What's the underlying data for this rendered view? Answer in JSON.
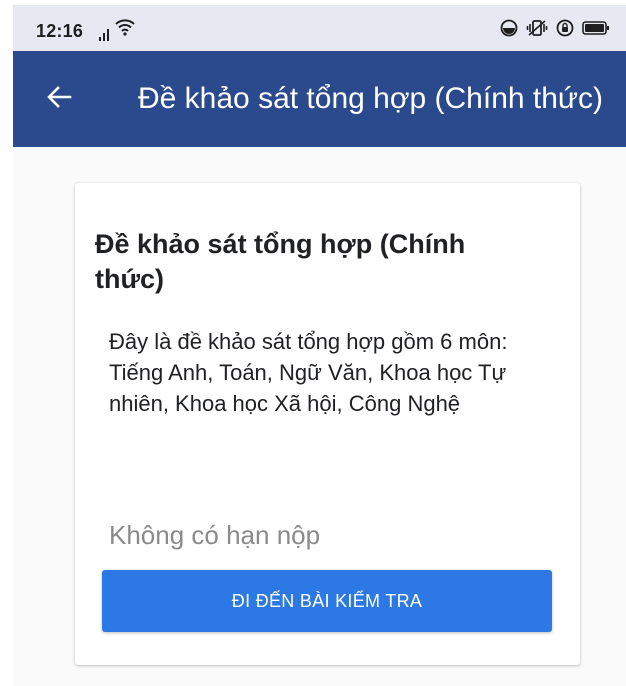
{
  "status_bar": {
    "time": "12:16",
    "icons": [
      "signal-icon",
      "wifi-icon",
      "focus-icon",
      "vibrate-icon",
      "alarm-icon",
      "battery-icon"
    ]
  },
  "app_bar": {
    "back_icon": "arrow-left-icon",
    "title": "Đề khảo sát tổng hợp (Chính thức)",
    "color": "#2b4a8e"
  },
  "card": {
    "title": "Đề khảo sát tổng hợp (Chính thức)",
    "description": "Đây là đề khảo sát tổng hợp gồm 6 môn: Tiếng Anh, Toán, Ngữ Văn, Khoa học Tự nhiên, Khoa học Xã hội, Công Nghệ",
    "deadline": "Không có hạn nộp",
    "button_label": "ĐI ĐẾN BÀI KIỂM TRA",
    "button_color": "#2c78e4"
  }
}
